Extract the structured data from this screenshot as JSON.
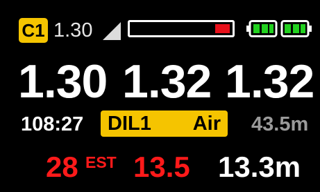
{
  "status_bar": {
    "badge": "C1",
    "setpoint": "1.30",
    "progress_fraction": 0.15,
    "colors": {
      "badge": "#f5c400",
      "bar_fill": "#e8101a",
      "battery": "#22d11f"
    }
  },
  "ppo2_sensors": [
    "1.30",
    "1.32",
    "1.32"
  ],
  "info_row": {
    "runtime": "108:27",
    "gas_name": "DIL1",
    "gas_type": "Air",
    "depth": "43.5m"
  },
  "bottom_row": {
    "value_1": "28",
    "value_1_suffix": "EST",
    "value_2": "13.5",
    "value_3": "13.3m"
  }
}
